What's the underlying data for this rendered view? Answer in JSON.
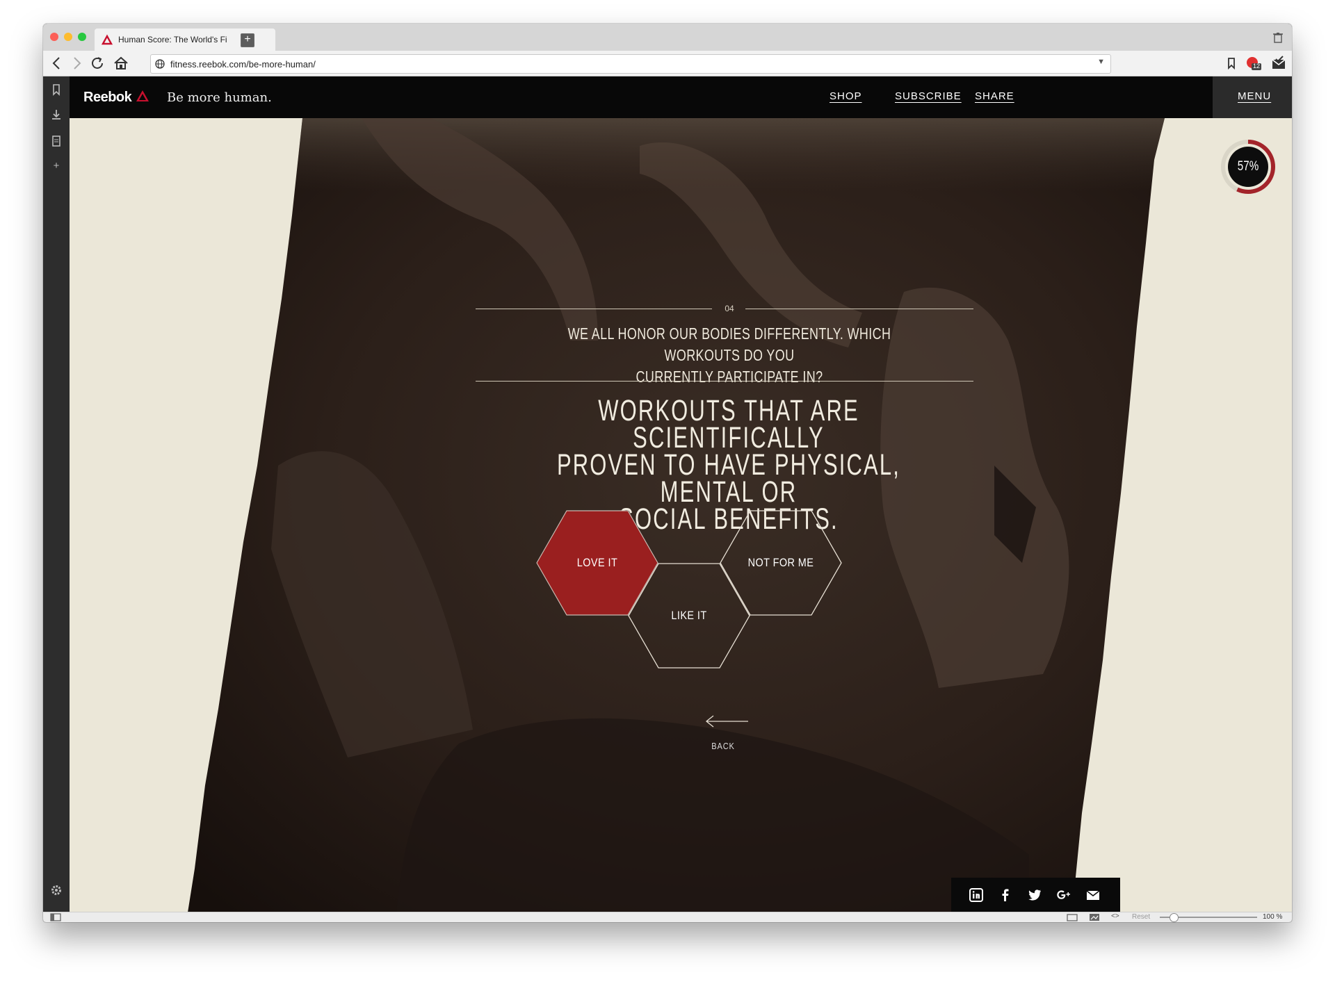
{
  "browser": {
    "tab_title": "Human Score: The World's Fi",
    "url": "fitness.reebok.com/be-more-human/",
    "badge_count": "12",
    "status_reset": "Reset",
    "zoom": "100 %"
  },
  "site": {
    "brand": "Reebok",
    "tagline": "Be more human.",
    "nav": {
      "shop": "SHOP",
      "subscribe": "SUBSCRIBE",
      "share": "SHARE",
      "menu": "MENU"
    }
  },
  "progress": {
    "label": "57%",
    "value": 0.57
  },
  "question": {
    "number": "04",
    "text_line1": "WE ALL HONOR OUR BODIES DIFFERENTLY. WHICH WORKOUTS DO YOU",
    "text_line2": "CURRENTLY PARTICIPATE IN?",
    "statement_line1": "WORKOUTS THAT ARE SCIENTIFICALLY",
    "statement_line2": "PROVEN TO HAVE PHYSICAL, MENTAL OR",
    "statement_line3": "SOCIAL BENEFITS."
  },
  "answers": {
    "love": "LOVE IT",
    "like": "LIKE IT",
    "not": "NOT FOR ME"
  },
  "back_label": "BACK",
  "share_icons": [
    "linkedin-icon",
    "facebook-icon",
    "twitter-icon",
    "google-plus-icon",
    "email-icon"
  ],
  "colors": {
    "accent": "#9a1f1f",
    "header": "#080808",
    "paper": "#ebe7d8"
  }
}
